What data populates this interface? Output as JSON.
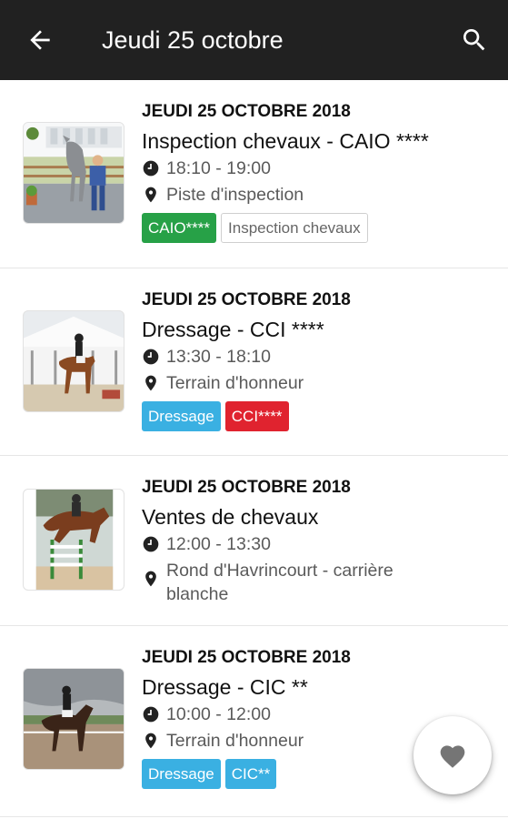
{
  "header": {
    "title": "Jeudi 25 octobre",
    "back_icon": "arrow-left-icon",
    "search_icon": "search-icon",
    "background": "#212121"
  },
  "events": [
    {
      "date": "JEUDI 25 OCTOBRE 2018",
      "title": "Inspection chevaux - CAIO ****",
      "time": "18:10 - 19:00",
      "location": "Piste d'inspection",
      "tags": [
        {
          "label": "CAIO****",
          "color": "#27a147"
        },
        {
          "label": "Inspection chevaux",
          "color": "outline"
        }
      ]
    },
    {
      "date": "JEUDI 25 OCTOBRE 2018",
      "title": "Dressage - CCI ****",
      "time": "13:30 - 18:10",
      "location": "Terrain d'honneur",
      "tags": [
        {
          "label": "Dressage",
          "color": "#3ab0e2"
        },
        {
          "label": "CCI****",
          "color": "#e0232f"
        }
      ]
    },
    {
      "date": "JEUDI 25 OCTOBRE 2018",
      "title": "Ventes de chevaux",
      "time": "12:00 - 13:30",
      "location": "Rond d'Havrincourt - carrière blanche",
      "tags": []
    },
    {
      "date": "JEUDI 25 OCTOBRE 2018",
      "title": "Dressage - CIC **",
      "time": "10:00 - 12:00",
      "location": "Terrain d'honneur",
      "tags": [
        {
          "label": "Dressage",
          "color": "#3ab0e2"
        },
        {
          "label": "CIC**",
          "color": "#3ab0e2"
        }
      ]
    }
  ],
  "fab": {
    "icon": "heart-icon"
  }
}
